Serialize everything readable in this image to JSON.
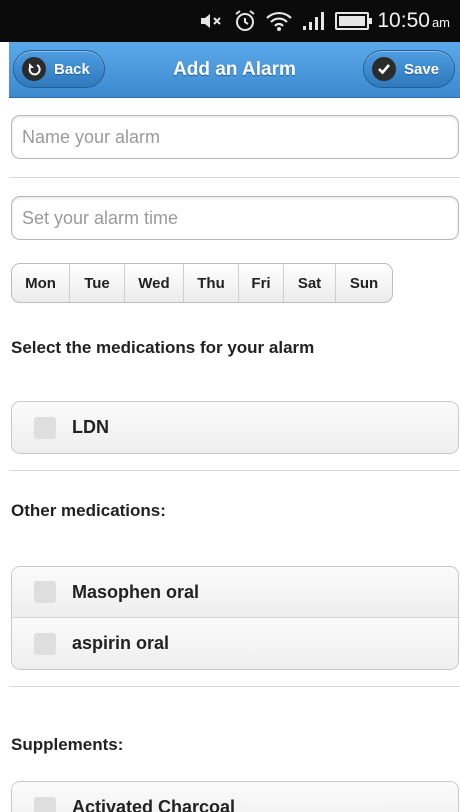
{
  "status_bar": {
    "time": "10:50",
    "ampm": "am"
  },
  "header": {
    "title": "Add an Alarm",
    "back_label": "Back",
    "save_label": "Save"
  },
  "form": {
    "name_placeholder": "Name your alarm",
    "time_placeholder": "Set your alarm time",
    "days": [
      "Mon",
      "Tue",
      "Wed",
      "Thu",
      "Fri",
      "Sat",
      "Sun"
    ]
  },
  "sections": {
    "medications_heading": "Select the medications for your alarm",
    "medications": [
      "LDN"
    ],
    "other_heading": "Other medications:",
    "other": [
      "Masophen oral",
      "aspirin oral"
    ],
    "supplements_heading": "Supplements:",
    "supplements": [
      "Activated Charcoal"
    ]
  },
  "colors": {
    "header_blue": "#4a99df",
    "status_bar": "#0b0b0b",
    "checkbox": "#dedede"
  }
}
